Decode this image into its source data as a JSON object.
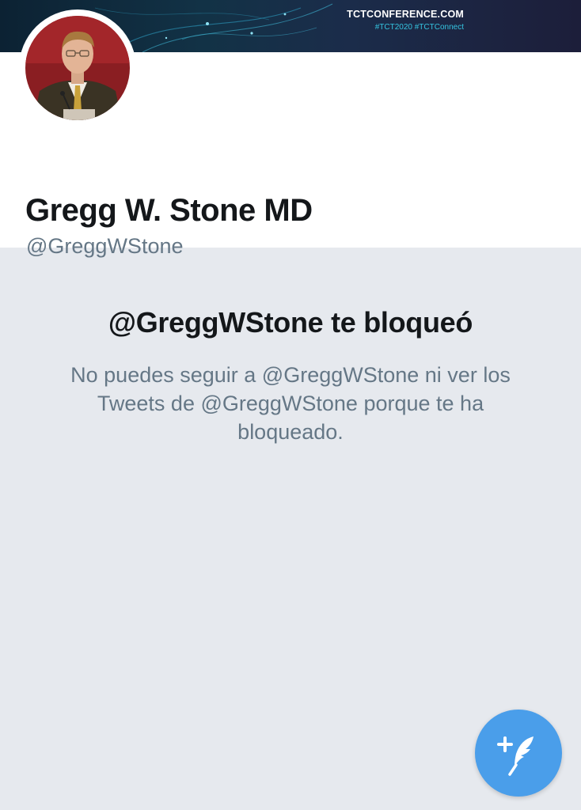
{
  "banner": {
    "site": "TCTCONFERENCE.COM",
    "tags": "#TCT2020 #TCTConnect"
  },
  "profile": {
    "display_name": "Gregg W. Stone MD",
    "handle": "@GreggWStone"
  },
  "blocked": {
    "title": "@GreggWStone te bloqueó",
    "message": "No puedes seguir a @GreggWStone ni ver los Tweets de @GreggWStone porque te ha bloqueado."
  },
  "colors": {
    "accent": "#4a9eea",
    "background": "#e6e9ee",
    "text_primary": "#14171a",
    "text_secondary": "#657786"
  },
  "icons": {
    "compose": "compose-tweet-icon"
  }
}
